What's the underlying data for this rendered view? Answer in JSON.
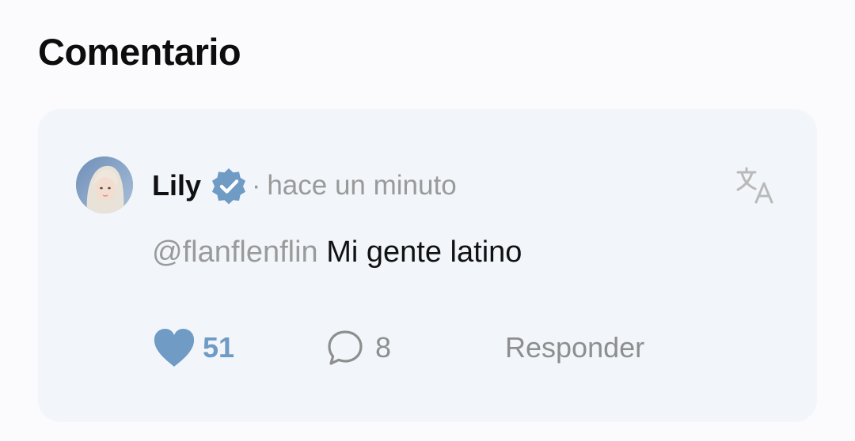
{
  "page": {
    "heading": "Comentario"
  },
  "comment": {
    "author": "Lily",
    "verified": true,
    "separator": "·",
    "time": "hace un minuto",
    "mention": "@flanflenflin",
    "text": "Mi gente latino",
    "likes": "51",
    "replies_count": "8",
    "reply_label": "Responder"
  },
  "icons": {
    "verified": "verified-badge-icon",
    "translate": "translate-icon",
    "like": "heart-icon",
    "comment": "comment-bubble-icon"
  },
  "colors": {
    "accent": "#6f9bc4",
    "card_background": "#f2f6fa",
    "muted_text": "#9a9a9a"
  }
}
